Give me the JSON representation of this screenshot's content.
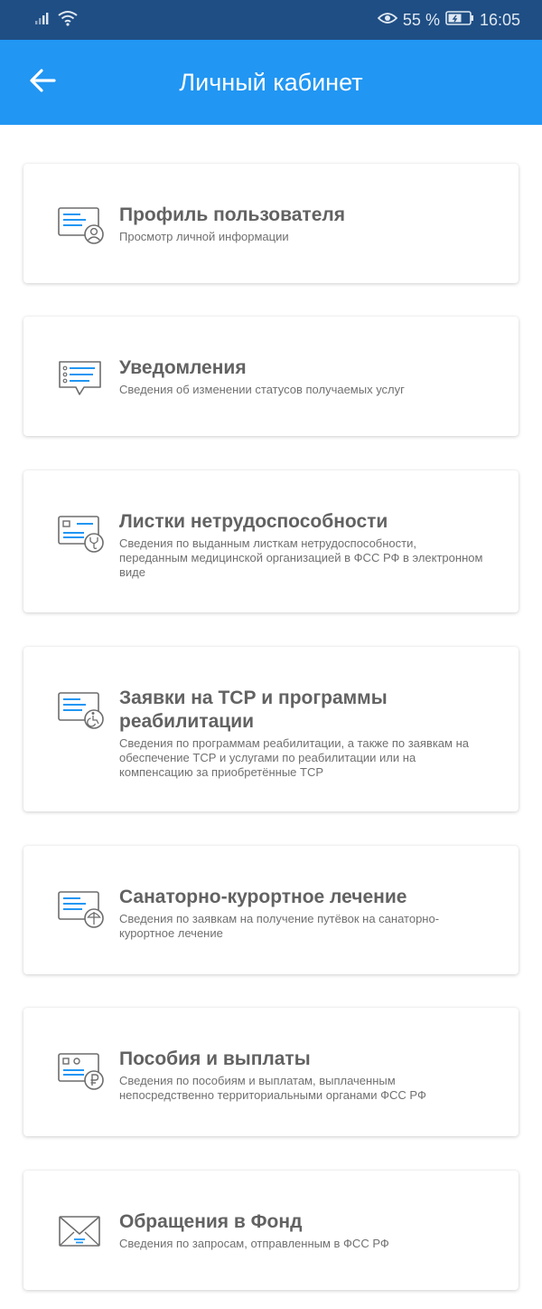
{
  "status_bar": {
    "battery_percent": "55 %",
    "time": "16:05",
    "icons": [
      "signal-icon",
      "wifi-icon",
      "eye-comfort-icon",
      "battery-icon"
    ]
  },
  "header": {
    "back_icon": "arrow-back-icon",
    "title": "Личный кабинет"
  },
  "colors": {
    "status_bar": "#1f4e84",
    "app_bar": "#2196f3",
    "icon_accent": "#2196f3",
    "icon_stroke": "#6d6d6d",
    "title_text": "#626262"
  },
  "cards": [
    {
      "icon": "profile-document-icon",
      "title": "Профиль пользователя",
      "description": "Просмотр личной информации"
    },
    {
      "icon": "notifications-list-icon",
      "title": "Уведомления",
      "description": "Сведения об изменении статусов получаемых услуг"
    },
    {
      "icon": "sick-leave-icon",
      "title": "Листки нетрудоспособности",
      "description": "Сведения по выданным листкам нетрудоспособности, переданным медицинской организацией в ФСС РФ в электронном виде"
    },
    {
      "icon": "rehabilitation-icon",
      "title": "Заявки на ТСР и программы реабилитации",
      "description": "Сведения по программам реабилитации, а также по заявкам на обеспечение ТСР и услугами по реабилитации или на компенсацию за приобретённые ТСР"
    },
    {
      "icon": "sanatorium-icon",
      "title": "Санаторно-курортное лечение",
      "description": "Сведения по заявкам на получение путёвок на санаторно-курортное лечение"
    },
    {
      "icon": "benefits-ruble-icon",
      "title": "Пособия и выплаты",
      "description": "Сведения по пособиям и выплатам, выплаченным непосредственно территориальными органами ФСС РФ"
    },
    {
      "icon": "envelope-icon",
      "title": "Обращения в Фонд",
      "description": "Сведения по запросам, отправленным в ФСС РФ"
    }
  ]
}
